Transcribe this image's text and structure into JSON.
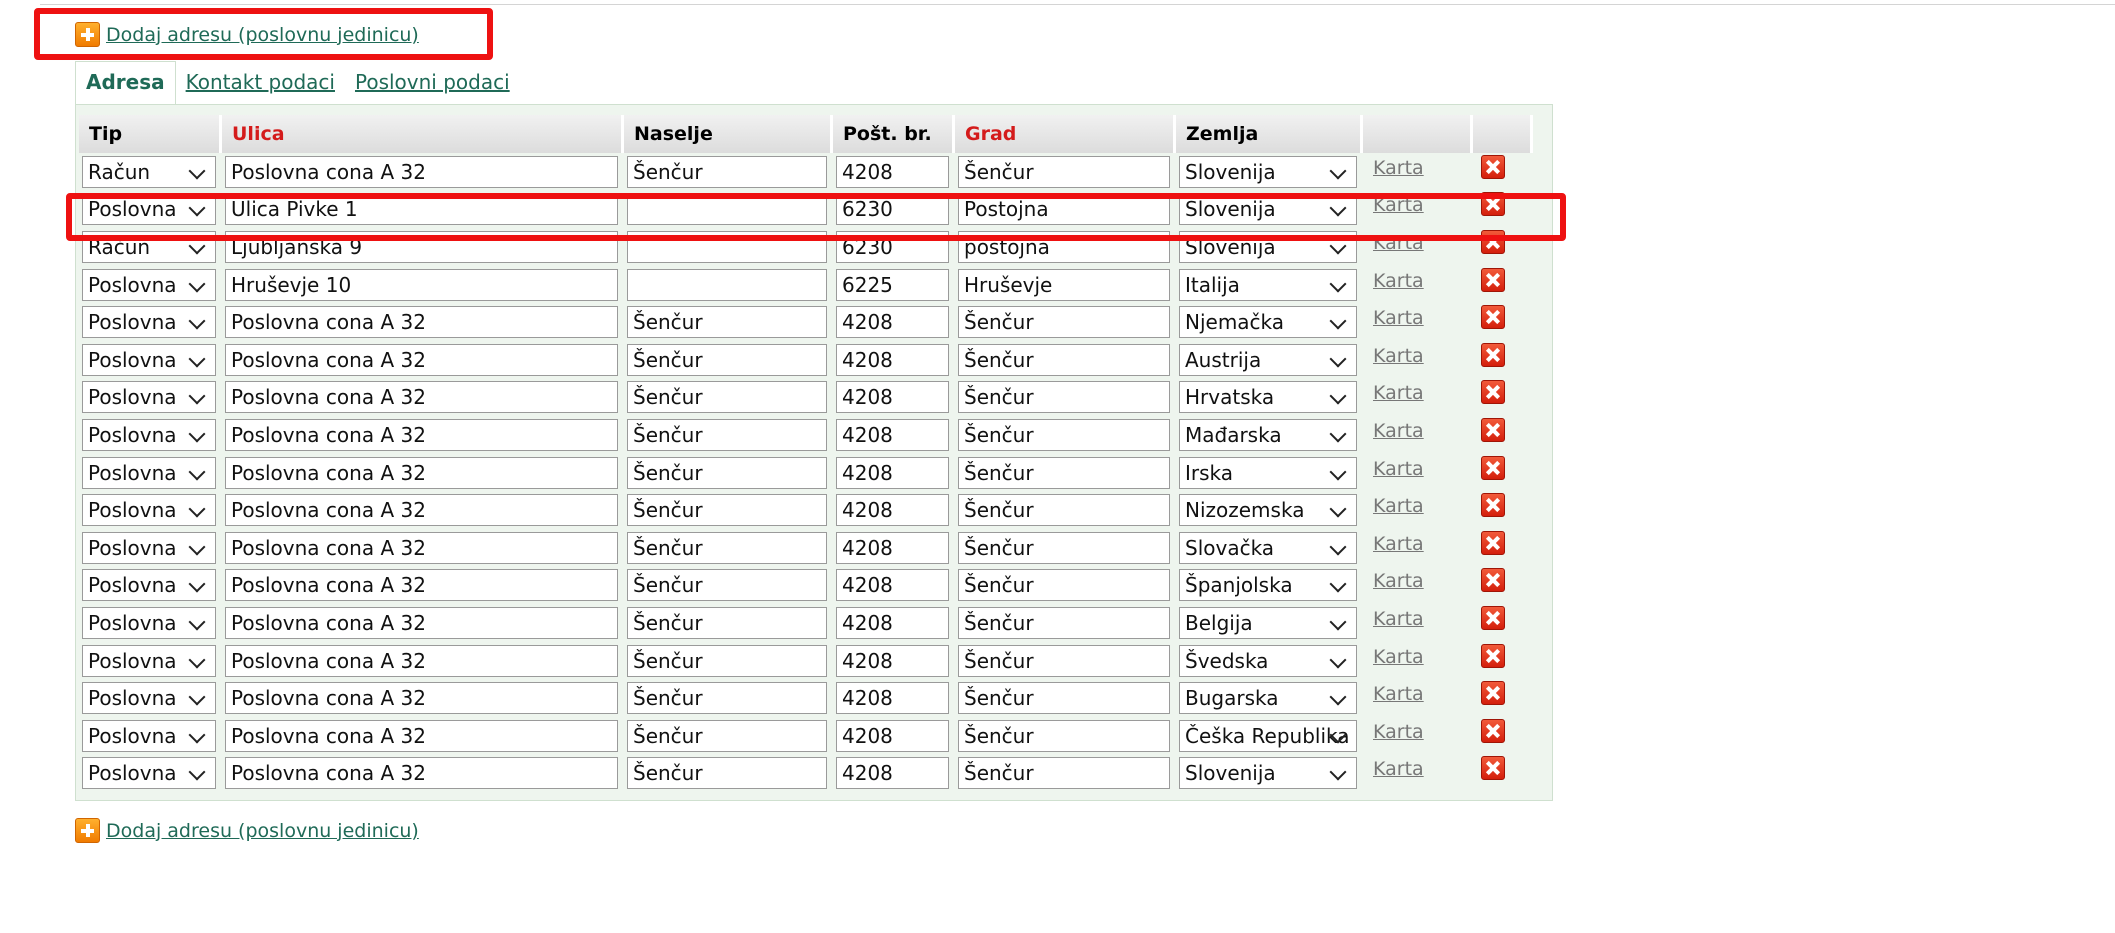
{
  "add_address_label": "Dodaj adresu (poslovnu jedinicu)",
  "tabs": [
    {
      "label": "Adresa",
      "active": true
    },
    {
      "label": "Kontakt podaci",
      "active": false
    },
    {
      "label": "Poslovni podaci",
      "active": false
    }
  ],
  "table": {
    "headers": {
      "tip": "Tip",
      "ulica": "Ulica",
      "naselje": "Naselje",
      "post_br": "Pošt. br.",
      "grad": "Grad",
      "zemlja": "Zemlja"
    },
    "link_label": "Karta",
    "rows": [
      {
        "tip": "Račun",
        "ulica": "Poslovna cona A 32",
        "naselje": "Šenčur",
        "post_br": "4208",
        "grad": "Šenčur",
        "zemlja": "Slovenija"
      },
      {
        "tip": "Poslovna",
        "ulica": "Ulica Pivke 1",
        "naselje": "",
        "post_br": "6230",
        "grad": "Postojna",
        "zemlja": "Slovenija"
      },
      {
        "tip": "Račun",
        "ulica": "Ljubljanska 9",
        "naselje": "",
        "post_br": "6230",
        "grad": "postojna",
        "zemlja": "Slovenija"
      },
      {
        "tip": "Poslovna",
        "ulica": "Hruševje 10",
        "naselje": "",
        "post_br": "6225",
        "grad": "Hruševje",
        "zemlja": "Italija"
      },
      {
        "tip": "Poslovna",
        "ulica": "Poslovna cona A 32",
        "naselje": "Šenčur",
        "post_br": "4208",
        "grad": "Šenčur",
        "zemlja": "Njemačka"
      },
      {
        "tip": "Poslovna",
        "ulica": "Poslovna cona A 32",
        "naselje": "Šenčur",
        "post_br": "4208",
        "grad": "Šenčur",
        "zemlja": "Austrija"
      },
      {
        "tip": "Poslovna",
        "ulica": "Poslovna cona A 32",
        "naselje": "Šenčur",
        "post_br": "4208",
        "grad": "Šenčur",
        "zemlja": "Hrvatska"
      },
      {
        "tip": "Poslovna",
        "ulica": "Poslovna cona A 32",
        "naselje": "Šenčur",
        "post_br": "4208",
        "grad": "Šenčur",
        "zemlja": "Mađarska"
      },
      {
        "tip": "Poslovna",
        "ulica": "Poslovna cona A 32",
        "naselje": "Šenčur",
        "post_br": "4208",
        "grad": "Šenčur",
        "zemlja": "Irska"
      },
      {
        "tip": "Poslovna",
        "ulica": "Poslovna cona A 32",
        "naselje": "Šenčur",
        "post_br": "4208",
        "grad": "Šenčur",
        "zemlja": "Nizozemska"
      },
      {
        "tip": "Poslovna",
        "ulica": "Poslovna cona A 32",
        "naselje": "Šenčur",
        "post_br": "4208",
        "grad": "Šenčur",
        "zemlja": "Slovačka"
      },
      {
        "tip": "Poslovna",
        "ulica": "Poslovna cona A 32",
        "naselje": "Šenčur",
        "post_br": "4208",
        "grad": "Šenčur",
        "zemlja": "Španjolska"
      },
      {
        "tip": "Poslovna",
        "ulica": "Poslovna cona A 32",
        "naselje": "Šenčur",
        "post_br": "4208",
        "grad": "Šenčur",
        "zemlja": "Belgija"
      },
      {
        "tip": "Poslovna",
        "ulica": "Poslovna cona A 32",
        "naselje": "Šenčur",
        "post_br": "4208",
        "grad": "Šenčur",
        "zemlja": "Švedska"
      },
      {
        "tip": "Poslovna",
        "ulica": "Poslovna cona A 32",
        "naselje": "Šenčur",
        "post_br": "4208",
        "grad": "Šenčur",
        "zemlja": "Bugarska"
      },
      {
        "tip": "Poslovna",
        "ulica": "Poslovna cona A 32",
        "naselje": "Šenčur",
        "post_br": "4208",
        "grad": "Šenčur",
        "zemlja": "Češka Republika"
      },
      {
        "tip": "Poslovna",
        "ulica": "Poslovna cona A 32",
        "naselje": "Šenčur",
        "post_br": "4208",
        "grad": "Šenčur",
        "zemlja": "Slovenija"
      }
    ]
  },
  "icons": {
    "add": "plus-icon",
    "delete": "delete-icon",
    "select": "chevron-down-icon"
  },
  "colors": {
    "link": "#1f6a57",
    "required_header": "#d41b1b",
    "highlight": "#ee1111",
    "panel_bg": "#eef5ee"
  }
}
